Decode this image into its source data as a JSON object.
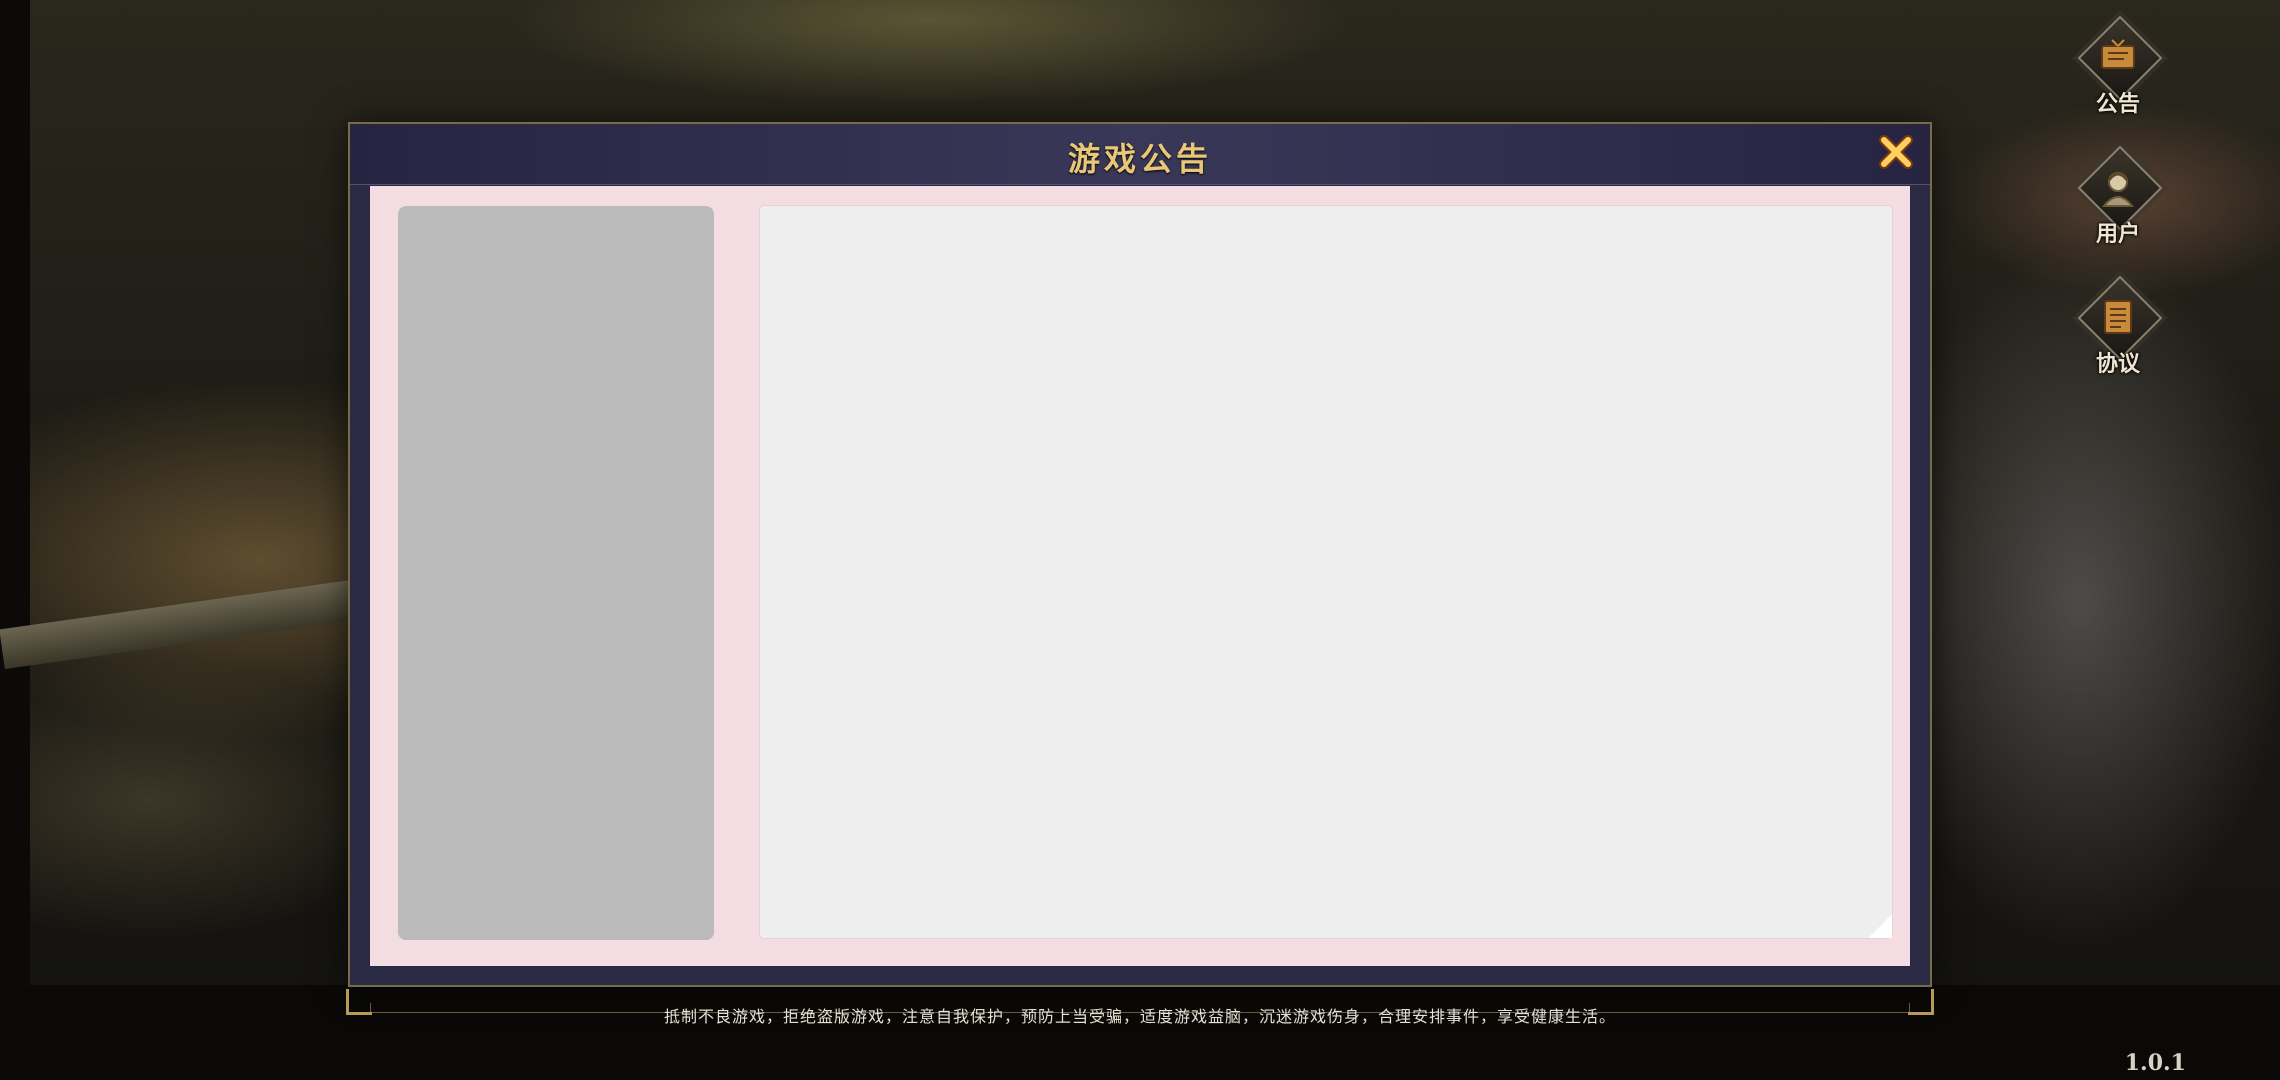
{
  "dialog": {
    "title": "游戏公告"
  },
  "side_buttons": [
    {
      "label": "公告",
      "icon": "notice-board-icon"
    },
    {
      "label": "用户",
      "icon": "user-avatar-icon"
    },
    {
      "label": "协议",
      "icon": "document-icon"
    }
  ],
  "footer": {
    "notice": "抵制不良游戏，拒绝盗版游戏，注意自我保护，预防上当受骗，适度游戏益脑，沉迷游戏伤身，合理安排事件，享受健康生活。",
    "version": "1.0.1"
  },
  "colors": {
    "title_gold": "#e8c777",
    "dialog_frame": "#2b2a45",
    "body_pink": "#f3dde3",
    "sidebar_gray": "#bababa",
    "content_panel": "#eeeeee",
    "close_orange": "#f0a020"
  }
}
